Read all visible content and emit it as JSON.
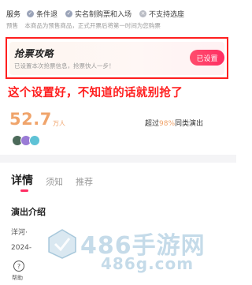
{
  "service": {
    "title": "服务",
    "items": [
      {
        "label": "条件退",
        "icon": "check-circle-icon"
      },
      {
        "label": "实名制购票和入场",
        "icon": "check-circle-icon"
      },
      {
        "label": "不支持选座",
        "icon": "cross-circle-icon"
      }
    ]
  },
  "presale": {
    "label": "预售",
    "text": "本商品为预售商品，正式开票后将第一时间为您购票"
  },
  "strategy": {
    "title": "抢票攻略",
    "description": "已设置本次抢票信息，抢票快人一步！",
    "button_label": "已设置"
  },
  "annotation": "这个设置好，不知道的话就别抢了",
  "want": {
    "count": "52.7",
    "unit": "万人",
    "exceed_prefix": "超过",
    "exceed_percent": "98%",
    "exceed_suffix": "同类演出"
  },
  "tabs": [
    {
      "label": "详情",
      "active": true
    },
    {
      "label": "须知",
      "active": false
    },
    {
      "label": "推荐",
      "active": false
    }
  ],
  "details": {
    "section_title": "演出介绍",
    "line1": "洋河·",
    "line2": "2024-"
  },
  "help": {
    "label": "帮助",
    "icon": "help-icon"
  },
  "watermark": {
    "title": "486手游网",
    "url": "486g.com"
  },
  "colors": {
    "accent": "#ff2e63",
    "orange": "#f0a46b",
    "annotation_red": "#ff1f1f"
  }
}
